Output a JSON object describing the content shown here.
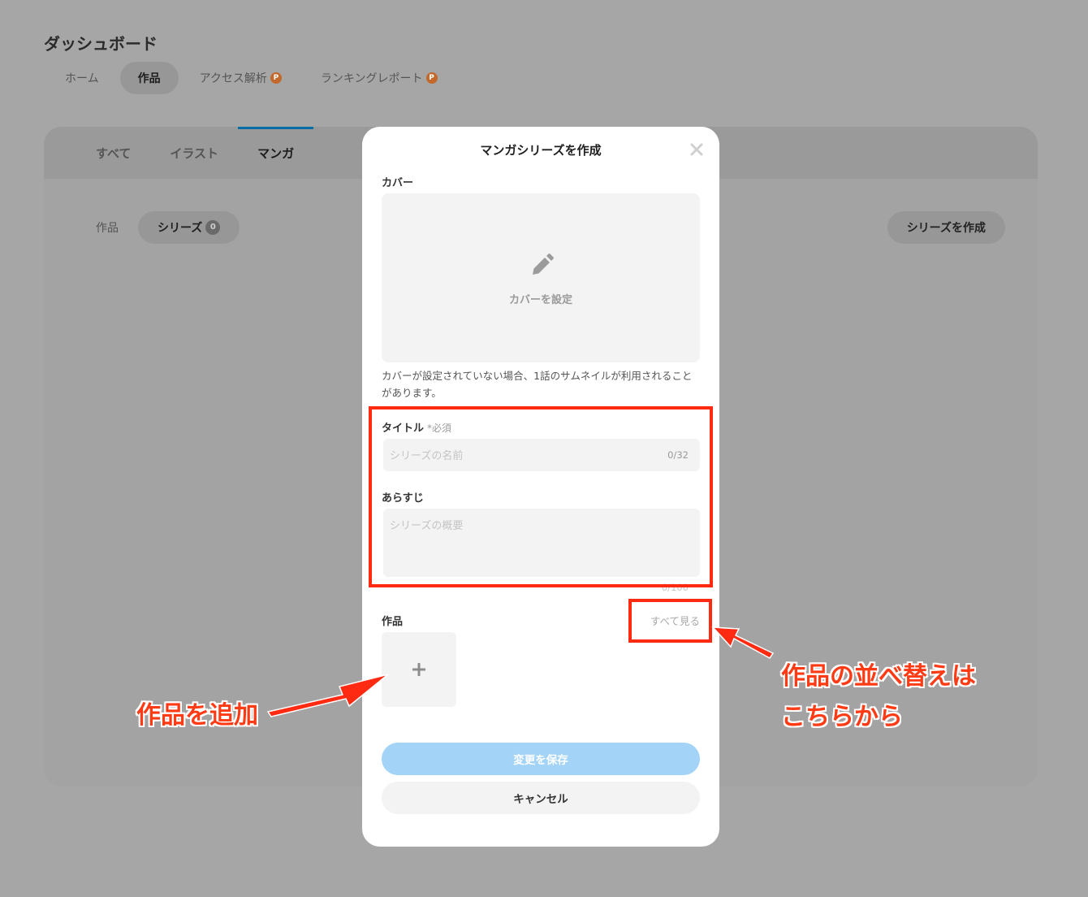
{
  "dashboard": {
    "title": "ダッシュボード",
    "nav": [
      {
        "label": "ホーム"
      },
      {
        "label": "作品"
      },
      {
        "label": "アクセス解析",
        "badge": "P"
      },
      {
        "label": "ランキングレポート",
        "badge": "P"
      }
    ],
    "tabs": [
      "すべて",
      "イラスト",
      "マンガ"
    ],
    "filter": {
      "works_label": "作品",
      "series_label": "シリーズ",
      "series_count": "0"
    },
    "create_series_label": "シリーズを作成"
  },
  "modal": {
    "title": "マンガシリーズを作成",
    "cover_label": "カバー",
    "cover_set_label": "カバーを設定",
    "cover_note": "カバーが設定されていない場合、1話のサムネイルが利用されることがあります。",
    "title_label": "タイトル",
    "title_required": "*必須",
    "title_placeholder": "シリーズの名前",
    "title_counter": "0/32",
    "synopsis_label": "あらすじ",
    "synopsis_placeholder": "シリーズの概要",
    "synopsis_counter": "0/100",
    "works_label": "作品",
    "see_all_label": "すべて見る",
    "save_label": "変更を保存",
    "cancel_label": "キャンセル"
  },
  "annotations": {
    "add_work": "作品を追加",
    "reorder_line1": "作品の並べ替えは",
    "reorder_line2": "こちらから",
    "color": "#ff2a12"
  }
}
